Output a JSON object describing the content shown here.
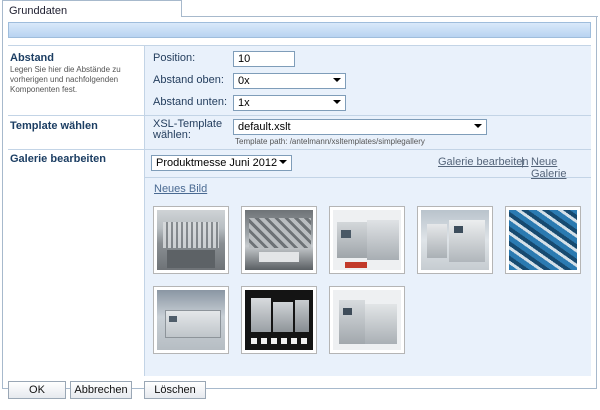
{
  "tab": {
    "label": "Grunddaten"
  },
  "abstand": {
    "title": "Abstand",
    "description": "Legen Sie hier die Abstände zu vorherigen und nachfolgenden Komponenten fest.",
    "position_label": "Position:",
    "position_value": "10",
    "oben_label": "Abstand oben:",
    "oben_value": "0x",
    "unten_label": "Abstand unten:",
    "unten_value": "1x"
  },
  "template": {
    "title": "Template wählen",
    "xsl_label_line1": "XSL-Template",
    "xsl_label_line2": "wählen:",
    "xsl_value": "default.xslt",
    "path_hint": "Template path: /antelmann/xsltemplates/simplegallery"
  },
  "galerie": {
    "title": "Galerie bearbeiten",
    "selected_gallery": "Produktmesse Juni 2012",
    "edit_link": "Galerie bearbeiten",
    "separator": "|",
    "new_gallery_link": "Neue Galerie",
    "new_image_link": "Neues Bild",
    "thumbnails": [
      {
        "name": "gallery-image-1"
      },
      {
        "name": "gallery-image-2"
      },
      {
        "name": "gallery-image-3"
      },
      {
        "name": "gallery-image-4"
      },
      {
        "name": "gallery-image-5"
      },
      {
        "name": "gallery-image-6"
      },
      {
        "name": "gallery-image-7"
      },
      {
        "name": "gallery-image-8"
      }
    ]
  },
  "buttons": {
    "ok": "OK",
    "cancel": "Abbrechen",
    "delete": "Löschen"
  },
  "colors": {
    "accent": "#b8d3f1",
    "panel_bg": "#e9f1fb",
    "border": "#a7b9cc"
  }
}
